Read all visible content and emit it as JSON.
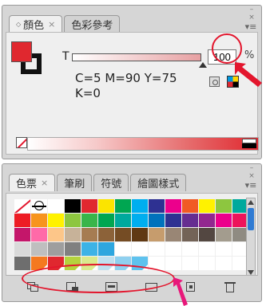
{
  "color_panel": {
    "tabs": [
      {
        "label": "顏色",
        "close": "×",
        "active": true
      },
      {
        "label": "色彩參考",
        "active": false
      }
    ],
    "window_controls": "– ×",
    "menu_icon": "menu-icon",
    "tint_label": "T",
    "tint_value": "100",
    "tint_unit": "%",
    "cmyk_line1": "C=5 M=90 Y=75",
    "cmyk_line2": "K=0",
    "fill_color": "#e0282f",
    "stroke_color": "#111111"
  },
  "swatches_panel": {
    "tabs": [
      {
        "label": "色票",
        "close": "×",
        "active": true
      },
      {
        "label": "筆刷",
        "active": false
      },
      {
        "label": "符號",
        "active": false
      },
      {
        "label": "繪圖樣式",
        "active": false
      }
    ],
    "window_controls": "– ×",
    "menu_icon": "menu-icon",
    "swatches": [
      "none",
      "registration",
      "#ffffff",
      "#000000",
      "#e0282f",
      "#fbe400",
      "#00a651",
      "#00aeef",
      "#2e3192",
      "#ec008c",
      "#f15a24",
      "#fff200",
      "#8dc63f",
      "#00a99d",
      "#ed1c24",
      "#f7941d",
      "#fff200",
      "#8dc63f",
      "#39b54a",
      "#00a651",
      "#00a99d",
      "#00aeef",
      "#0072bc",
      "#2e3192",
      "#662d91",
      "#92278f",
      "#ec008c",
      "#ed145b",
      "#c4166a",
      "#ff6aa8",
      "#fdc689",
      "#c7b299",
      "#a67c52",
      "#8c6239",
      "#754c24",
      "#603913",
      "#c69c6d",
      "#998675",
      "#736357",
      "#534741",
      "#a39c8e",
      "#8f8b82",
      "#d9d9d9",
      "#bfbfbf",
      "#9e9e9e",
      "#808080",
      "#3cb3e6",
      "#2da6df",
      "#ffffff",
      "#ffffff",
      "#ffffff",
      "#ffffff",
      "#ffffff",
      "#ffffff",
      "#ffffff",
      "#ffffff",
      "#6e6e6e",
      "#f47920",
      "#e0282f",
      "#b5d33d",
      "#d9ea8d",
      "#bfe0f0",
      "#8fd0ef",
      "#5ec2ee",
      "#ffffff",
      "#ffffff",
      "#ffffff",
      "#ffffff",
      "#ffffff",
      "#ffffff"
    ],
    "toolbar_icons": [
      "swatch-libraries-icon",
      "show-swatch-kinds-icon",
      "swatch-options-icon",
      "new-color-group-icon",
      "new-swatch-icon",
      "delete-swatch-icon"
    ]
  },
  "annotations": {
    "circle_color": "#e3162d",
    "oval_color": "#e3162d",
    "arrow_color": "#e3162d",
    "arrow2_color": "#e8187a"
  }
}
